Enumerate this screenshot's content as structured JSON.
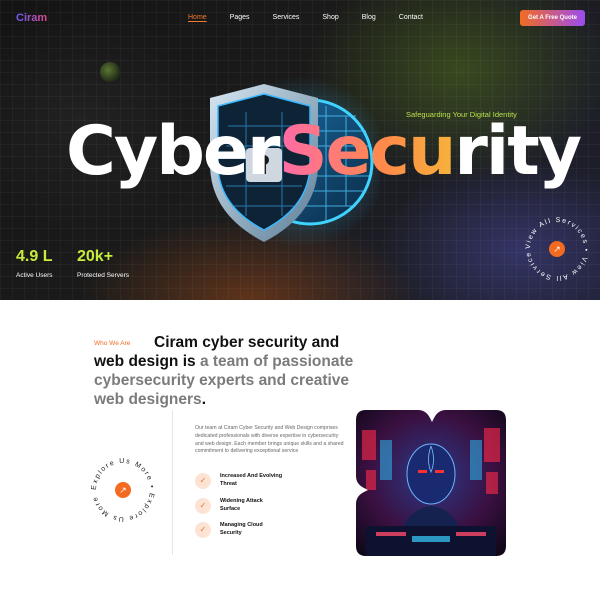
{
  "brand": {
    "name": "Ciram"
  },
  "nav": {
    "items": [
      {
        "label": "Home",
        "active": true
      },
      {
        "label": "Pages",
        "active": false
      },
      {
        "label": "Services",
        "active": false
      },
      {
        "label": "Shop",
        "active": false
      },
      {
        "label": "Blog",
        "active": false
      },
      {
        "label": "Contact",
        "active": false
      }
    ],
    "cta_label": "Get A Free Quote"
  },
  "hero": {
    "tagline": "Safeguarding Your Digital Identity",
    "title_part1": "Cyber",
    "title_part2": "Secu",
    "title_part3": "rity",
    "stats": [
      {
        "value": "4.9 L",
        "label": "Active Users"
      },
      {
        "value": "20k+",
        "label": "Protected Servers"
      }
    ],
    "badge_text": "View All Services • View All Services •"
  },
  "about": {
    "eyebrow": "Who We Are",
    "heading_bold": "Ciram cyber security and web design is",
    "heading_muted": " a team of passionate cybersecurity experts and creative web designers",
    "heading_end": ".",
    "paragraph": "Our team at Ciram Cyber Security and Web Design comprises dedicated professionals with diverse expertise in cybersecurity and web design. Each member brings unique skills and a shared commitment to delivering exceptional service",
    "features": [
      {
        "line1": "Increased And Evolving",
        "line2": "Threat"
      },
      {
        "line1": "Widening Attack",
        "line2": "Surface"
      },
      {
        "line1": "Managing Cloud",
        "line2": "Security"
      }
    ],
    "badge_text": "Explore Us More • Explore Us More •"
  },
  "colors": {
    "accent": "#f36b21",
    "lime": "#c8ec3c",
    "hero_bg": "#161616",
    "gradient_title": [
      "#ff6aa8",
      "#ff8a4a",
      "#f6b23a"
    ]
  },
  "icons": {
    "badge_arrow": "arrow-up-right-icon",
    "check": "check-icon"
  }
}
